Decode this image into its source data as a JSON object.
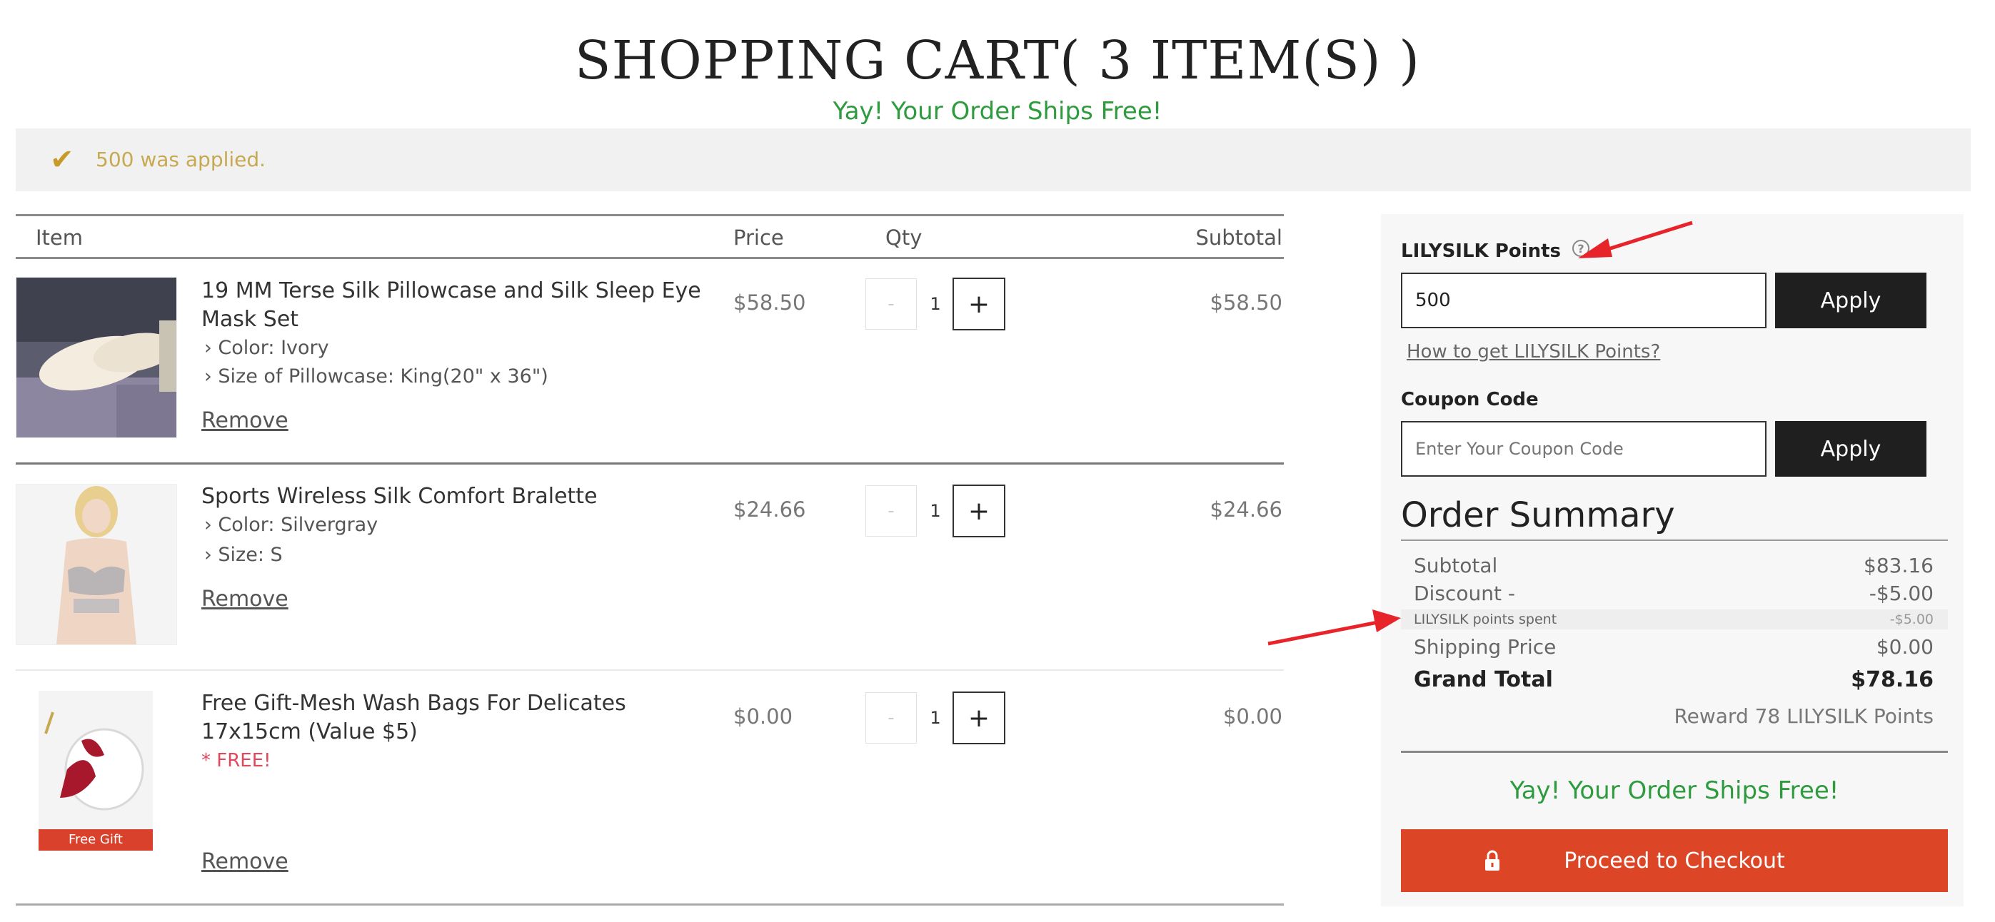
{
  "header": {
    "title": "SHOPPING CART( 3 ITEM(S) )",
    "ships_free": "Yay! Your Order Ships Free!"
  },
  "notice": {
    "icon": "checkmark-icon",
    "text": "500 was applied."
  },
  "table": {
    "headers": [
      "Item",
      "Price",
      "Qty",
      "Subtotal"
    ],
    "remove_label": "Remove",
    "qty_minus": "-",
    "qty_plus": "+",
    "items": [
      {
        "name": "19 MM Terse Silk Pillowcase and Silk Sleep Eye Mask Set",
        "options": [
          "Color: Ivory",
          "Size of Pillowcase: King(20\" x 36\")"
        ],
        "price": "$58.50",
        "qty": "1",
        "subtotal": "$58.50"
      },
      {
        "name": "Sports Wireless Silk Comfort Bralette",
        "options": [
          "Color: Silvergray",
          "Size: S"
        ],
        "price": "$24.66",
        "qty": "1",
        "subtotal": "$24.66"
      },
      {
        "name": "Free Gift-Mesh Wash Bags For Delicates 17x15cm (Value $5)",
        "note": "* FREE!",
        "badge": "Free Gift",
        "price": "$0.00",
        "qty": "1",
        "subtotal": "$0.00"
      }
    ]
  },
  "points": {
    "label": "LILYSILK Points",
    "help_icon": "question-circle-icon",
    "value": "500",
    "apply_label": "Apply",
    "how_link": "How to get LILYSILK Points?"
  },
  "coupon": {
    "label": "Coupon Code",
    "placeholder": "Enter Your Coupon Code",
    "apply_label": "Apply"
  },
  "summary": {
    "title": "Order Summary",
    "subtotal_label": "Subtotal",
    "subtotal_value": "$83.16",
    "discount_label": "Discount -",
    "discount_value": "-$5.00",
    "points_spent_label": "LILYSILK points spent",
    "points_spent_value": "-$5.00",
    "shipping_label": "Shipping Price",
    "shipping_value": "$0.00",
    "grand_total_label": "Grand Total",
    "grand_total_value": "$78.16",
    "reward": "Reward 78 LILYSILK Points",
    "ships_free": "Yay! Your Order Ships Free!",
    "checkout_label": "Proceed to Checkout",
    "checkout_icon": "lock-icon"
  },
  "colors": {
    "ships_free_green": "#2e9b3e",
    "checkout_orange": "#dc4627",
    "notice_gold": "#c79a2a",
    "annotation_red": "#e8242b"
  }
}
